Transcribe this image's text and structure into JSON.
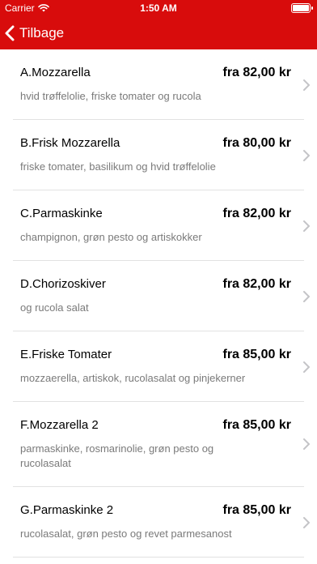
{
  "status": {
    "carrier": "Carrier",
    "time": "1:50 AM"
  },
  "nav": {
    "back_label": "Tilbage"
  },
  "items": [
    {
      "title": "A.Mozzarella",
      "price": "fra 82,00 kr",
      "desc": "hvid trøffelolie, friske tomater og rucola"
    },
    {
      "title": "B.Frisk Mozzarella",
      "price": "fra 80,00 kr",
      "desc": "friske tomater, basilikum og hvid trøffelolie"
    },
    {
      "title": "C.Parmaskinke",
      "price": "fra 82,00 kr",
      "desc": "champignon, grøn pesto og artiskokker"
    },
    {
      "title": "D.Chorizoskiver",
      "price": "fra 82,00 kr",
      "desc": "og rucola salat"
    },
    {
      "title": "E.Friske Tomater",
      "price": "fra 85,00 kr",
      "desc": "mozzaerella, artiskok, rucolasalat og pinjekerner"
    },
    {
      "title": "F.Mozzarella 2",
      "price": "fra 85,00 kr",
      "desc": "parmaskinke, rosmarinolie, grøn pesto og rucolasalat"
    },
    {
      "title": "G.Parmaskinke 2",
      "price": "fra 85,00 kr",
      "desc": "rucolasalat, grøn pesto og revet parmesanost"
    }
  ],
  "colors": {
    "brand": "#d80c0c",
    "secondary_text": "#7a7a7a"
  }
}
